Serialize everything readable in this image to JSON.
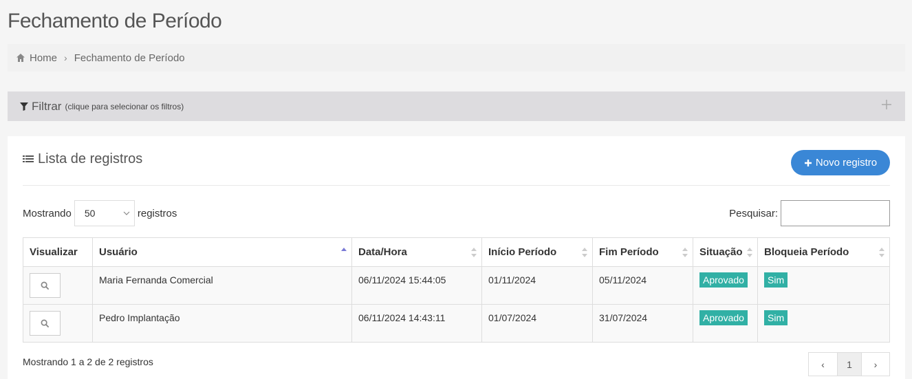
{
  "page": {
    "title": "Fechamento de Período"
  },
  "breadcrumb": {
    "home": "Home",
    "current": "Fechamento de Período"
  },
  "filter": {
    "title": "Filtrar",
    "hint": "(clique para selecionar os filtros)"
  },
  "list": {
    "title": "Lista de registros",
    "new_button": "Novo registro",
    "length_prefix": "Mostrando",
    "length_value": "50",
    "length_suffix": "registros",
    "search_label": "Pesquisar:",
    "search_value": "",
    "columns": [
      "Visualizar",
      "Usuário",
      "Data/Hora",
      "Início Período",
      "Fim Período",
      "Situação",
      "Bloqueia Período"
    ],
    "rows": [
      {
        "usuario": "Maria Fernanda Comercial",
        "data_hora": "06/11/2024 15:44:05",
        "inicio": "01/11/2024",
        "fim": "05/11/2024",
        "situacao": "Aprovado",
        "bloqueia": "Sim"
      },
      {
        "usuario": "Pedro Implantação",
        "data_hora": "06/11/2024 14:43:11",
        "inicio": "01/07/2024",
        "fim": "31/07/2024",
        "situacao": "Aprovado",
        "bloqueia": "Sim"
      }
    ],
    "info": "Mostrando 1 a 2 de 2 registros",
    "pager": {
      "prev": "‹",
      "page": "1",
      "next": "›"
    }
  },
  "colors": {
    "accent": "#3a87d6",
    "badge": "#31b0a5"
  }
}
